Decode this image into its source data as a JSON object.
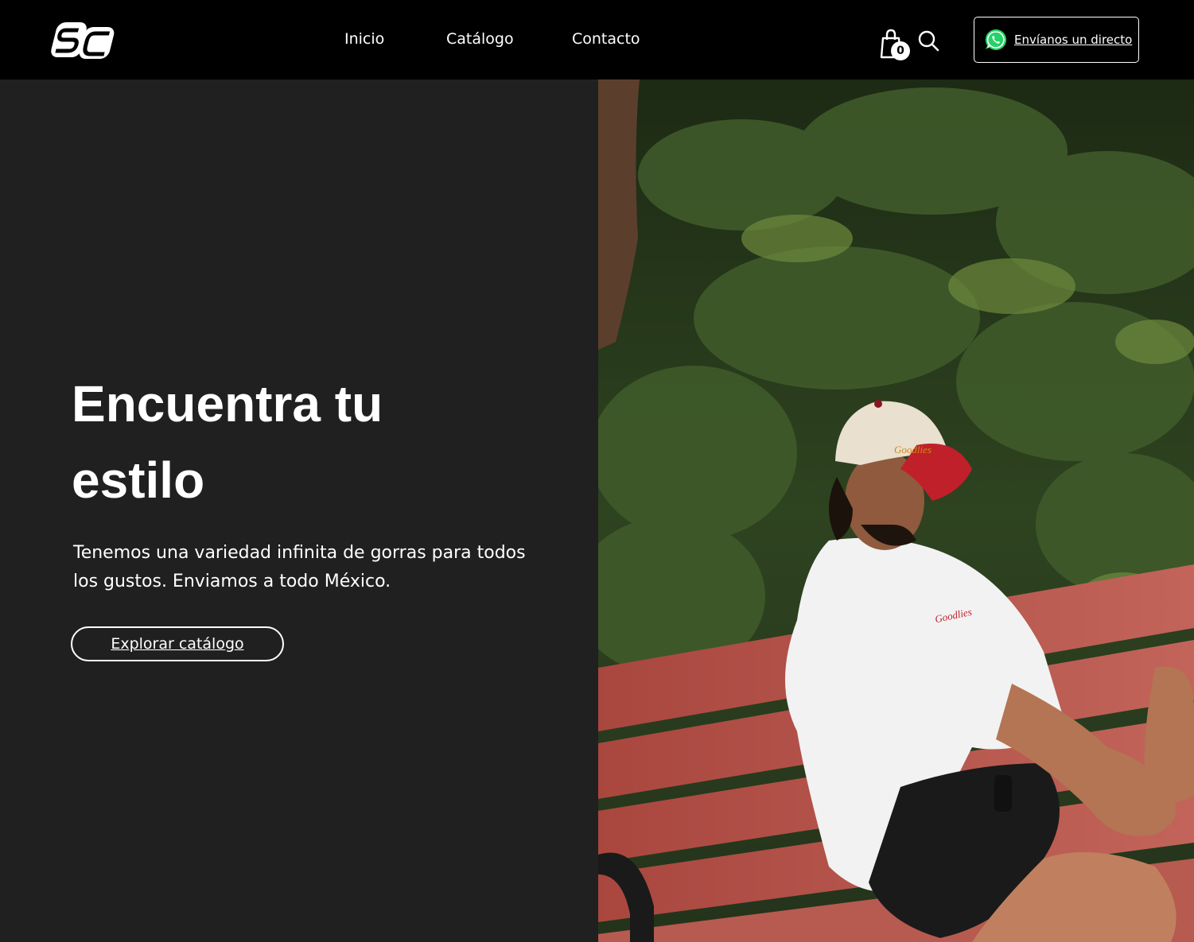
{
  "header": {
    "logo_text": "SC",
    "nav": [
      "Inicio",
      "Catálogo",
      "Contacto"
    ],
    "cart_count": "0",
    "whatsapp_label": "Envíanos un directo"
  },
  "hero": {
    "title_line1": "Encuentra tu",
    "title_line2": "estilo",
    "subtitle_line1": "Tenemos una variedad infinita de gorras para todos",
    "subtitle_line2": "los gustos. Enviamos a todo México.",
    "cta_label": "Explorar catálogo"
  },
  "photo": {
    "cap_text": "Goodlies",
    "shirt_text": "Goodlies"
  },
  "colors": {
    "header_bg": "#000000",
    "panel_bg": "#202020",
    "bench_red": "#b24f47",
    "cap_red": "#c0202a",
    "whatsapp_green": "#25d366"
  }
}
